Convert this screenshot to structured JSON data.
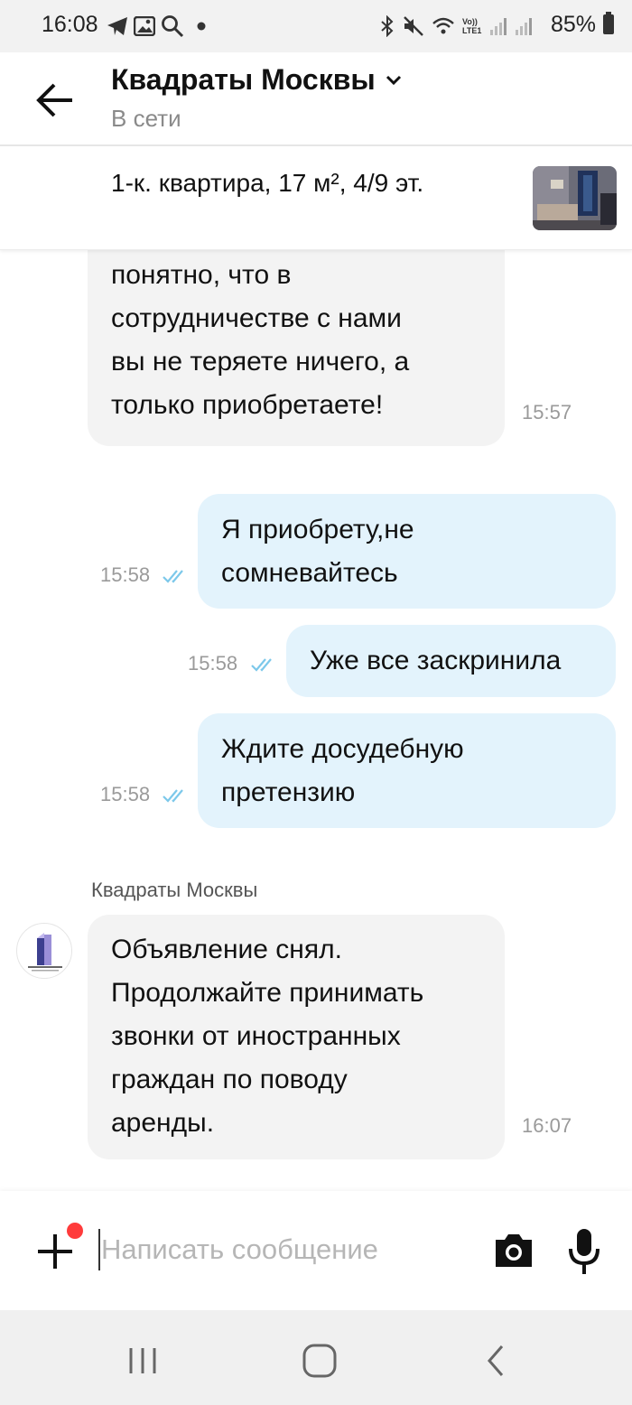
{
  "status_bar": {
    "time": "16:08",
    "battery": "85%",
    "network_label": "Vo)) LTE1",
    "left_icons": [
      "telegram-icon",
      "gallery-icon",
      "search-icon",
      "dot-icon"
    ],
    "right_icons": [
      "bluetooth-icon",
      "mute-icon",
      "wifi-icon",
      "signal-icon",
      "signal-icon",
      "battery-icon"
    ]
  },
  "header": {
    "title": "Квадраты Москвы",
    "subtitle": "В сети"
  },
  "listing": {
    "title": "1-к. квартира, 17 м², 4/9 эт."
  },
  "messages": [
    {
      "direction": "in",
      "text": "…понятно, что в сотрудничестве с нами вы не теряете ничего, а только приобретаете!",
      "lines": [
        "понятно, что в",
        "сотрудничестве с нами",
        "вы не теряете ничего, а",
        "только приобретаете!"
      ],
      "time": "15:57"
    },
    {
      "direction": "out",
      "lines": [
        "Я приобрету,не",
        "сомневайтесь"
      ],
      "time": "15:58",
      "status": "read"
    },
    {
      "direction": "out",
      "lines": [
        "Уже все заскринила"
      ],
      "time": "15:58",
      "status": "read"
    },
    {
      "direction": "out",
      "lines": [
        "Ждите досудебную",
        "претензию"
      ],
      "time": "15:58",
      "status": "read"
    },
    {
      "direction": "in",
      "sender": "Квадраты Москвы",
      "lines": [
        "Объявление снял.",
        "Продолжайте принимать",
        "звонки от иностранных",
        "граждан по поводу",
        "аренды."
      ],
      "time": "16:07"
    }
  ],
  "input": {
    "placeholder": "Написать сообщение",
    "value": ""
  },
  "colors": {
    "incoming_bubble": "#f3f3f3",
    "outgoing_bubble": "#e3f3fc",
    "read_ticks": "#7cc8ea",
    "notification_dot": "#ff3b3b"
  }
}
